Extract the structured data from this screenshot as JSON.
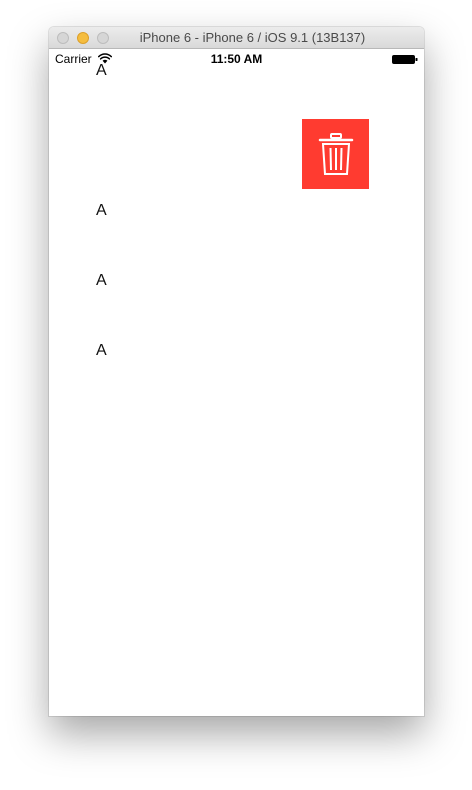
{
  "window": {
    "title": "iPhone 6 - iPhone 6 / iOS 9.1 (13B137)",
    "controls": [
      "close",
      "minimize",
      "zoom"
    ]
  },
  "status_bar": {
    "carrier": "Carrier",
    "wifi_icon": "wifi-icon",
    "time": "11:50 AM",
    "battery_icon": "battery-icon"
  },
  "list": {
    "rows": [
      {
        "label": "A"
      },
      {
        "label": "A"
      },
      {
        "label": "A"
      },
      {
        "label": "A"
      }
    ]
  },
  "delete_action": {
    "icon": "trash-icon",
    "color": "#ff3b30"
  }
}
